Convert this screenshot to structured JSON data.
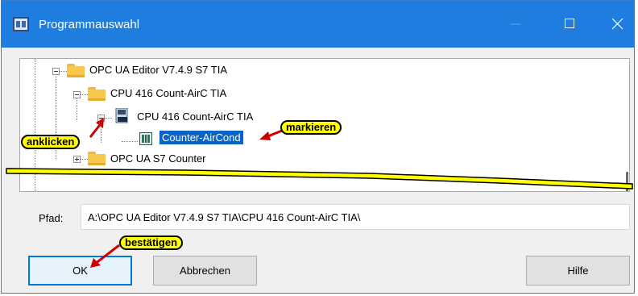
{
  "window": {
    "title": "Programmauswahl"
  },
  "titlebar_buttons": {
    "minimize": "minimize-icon",
    "maximize": "maximize-icon",
    "close": "close-icon"
  },
  "tree": {
    "nodes": [
      {
        "label": "OPC UA Editor V7.4.9 S7 TIA",
        "icon": "folder-icon",
        "state": "expanded"
      },
      {
        "label": "CPU 416 Count-AirC TIA",
        "icon": "folder-icon",
        "state": "expanded"
      },
      {
        "label": "CPU 416 Count-AirC TIA",
        "icon": "program-icon",
        "state": "expanded"
      },
      {
        "label": "Counter-AirCond",
        "icon": "block-icon",
        "state": "selected"
      },
      {
        "label": "OPC UA S7 Counter",
        "icon": "folder-icon",
        "state": "collapsed"
      }
    ]
  },
  "path": {
    "label": "Pfad:",
    "value": "A:\\OPC UA Editor V7.4.9 S7 TIA\\CPU 416 Count-AirC TIA\\"
  },
  "buttons": {
    "ok": "OK",
    "cancel": "Abbrechen",
    "help": "Hilfe"
  },
  "annotations": {
    "click": "anklicken",
    "mark": "markieren",
    "confirm": "bestätigen"
  },
  "colors": {
    "titlebar": "#1f7de0",
    "selection": "#0a64c8",
    "callout": "#ffff00",
    "arrow": "#cc0000"
  }
}
